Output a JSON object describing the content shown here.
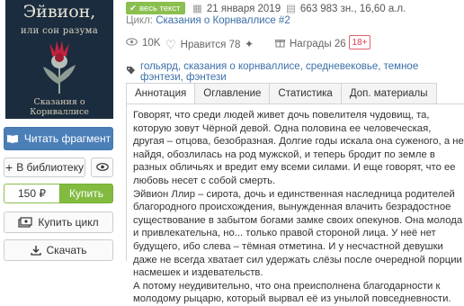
{
  "cover": {
    "title": "Эйвион,",
    "subtitle": "или сон разума",
    "series": "Сказания о Корнваллисе"
  },
  "left": {
    "read_label": "Читать фрагмент",
    "library_label": "В библиотеку",
    "price": "150 ₽",
    "buy_label": "Купить",
    "buy_cycle_label": "Купить цикл",
    "download_label": "Скачать"
  },
  "book": {
    "badge": "весь текст",
    "date": "21 января 2019",
    "size": "663 983 зн., 16,60 а.л.",
    "cycle_prefix": "Цикл:",
    "cycle_link": "Сказания о Корнваллисе #2",
    "views": "10K",
    "likes_label": "Нравится 78",
    "awards_label": "Награды 26",
    "age": "18+",
    "tags": "гольярд, сказания о корнваллисе, средневековье, темное фэнтези, фэнтези"
  },
  "tabs": [
    {
      "label": "Аннотация"
    },
    {
      "label": "Оглавление"
    },
    {
      "label": "Статистика"
    },
    {
      "label": "Доп. материалы"
    }
  ],
  "annotation": [
    "Говорят, что среди людей живет дочь повелителя чудовищ, та, которую зовут Чёрной девой. Одна половина ее человеческая, другая – отцова, безобразная. Долгие годы искала она суженого, а не найдя, обозлилась на род мужской, и теперь бродит по земле в разных обличьях и вредит ему всеми силами. И еще говорят, что ее любовь несет с собой смерть.",
    "Эйвион Ллир – сирота, дочь и единственная наследница родителей благородного происхождения, вынужденная влачить безрадостное существование в забытом богами замке своих опекунов. Она молода и привлекательна, но... только правой стороной лица. У неё нет будущего, ибо слева – тёмная отметина. И у несчастной девушки даже не всегда хватает сил удержать слёзы после очередной порции насмешек и издевательств.",
    "А потому неудивительно, что она преисполнена благодарности к молодому рыцарю, который вырвал её из унылой повседневности."
  ],
  "colors": {
    "primary_blue": "#4b7fb8",
    "buy_green": "#82bb3f",
    "link_blue": "#3b6fa8",
    "age_red": "#d94050"
  }
}
